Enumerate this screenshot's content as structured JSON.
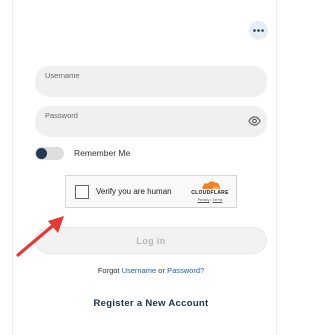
{
  "menu": {
    "icon": "more-horizontal-icon"
  },
  "form": {
    "username": {
      "label": "Username",
      "value": ""
    },
    "password": {
      "label": "Password",
      "value": "",
      "icon": "eye-icon"
    },
    "remember": {
      "label": "Remember Me",
      "checked": false
    }
  },
  "captcha": {
    "label": "Verify you are human",
    "brand": "CLOUDFLARE",
    "privacy_link": "Privacy",
    "separator": "•",
    "terms_link": "Terms",
    "checked": false
  },
  "annotation": {
    "icon": "red-arrow-icon",
    "color": "#e53935"
  },
  "login_button": {
    "label": "Log in",
    "enabled": false
  },
  "forgot": {
    "prefix": "Forgot",
    "username_link": "Username",
    "or": "or",
    "password_link": "Password?"
  },
  "register": {
    "label": "Register a New Account"
  },
  "colors": {
    "accent_dark": "#1f3a52",
    "link": "#1a5fb4",
    "cloudflare_orange": "#f38020"
  }
}
